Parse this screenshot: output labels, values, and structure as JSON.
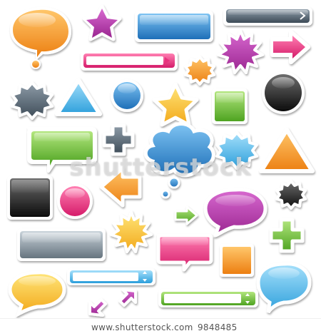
{
  "watermark": {
    "text": "shutterstock"
  },
  "footer": {
    "site": "www.shutterstock.com",
    "separator": "·",
    "image_id": "9848485"
  },
  "palette": {
    "orange": "#f39a2b",
    "magenta": "#b53aa7",
    "pink": "#e8337e",
    "blue": "#2f86cf",
    "sky": "#49b6e8",
    "green": "#6cbf3b",
    "yellow": "#f6c222",
    "black": "#1a1a1a",
    "slate": "#566775",
    "silver": "#8c99a4"
  },
  "icons": [
    "orange-speech-bubble-icon",
    "magenta-star-icon",
    "blue-pill-button-icon",
    "slate-arrow-bar-icon",
    "pink-right-arrow-icon",
    "magenta-starburst-icon",
    "pink-arrow-bar-icon",
    "orange-seal-icon",
    "slate-seal-icon",
    "blue-triangle-icon",
    "blue-circle-icon",
    "yellow-star-icon",
    "green-square-icon",
    "black-circle-icon",
    "green-speech-bubble-icon",
    "slate-plus-icon",
    "blue-thought-cloud-icon",
    "sky-seal-icon",
    "orange-triangle-icon",
    "black-rounded-square-icon",
    "pink-circle-icon",
    "orange-left-arrow-icon",
    "black-seal-icon",
    "green-small-arrow-icon",
    "magenta-speech-bubble-icon",
    "slate-bar-button-icon",
    "yellow-starburst-icon",
    "green-plus-icon",
    "pink-speech-bubble-icon",
    "orange-square-icon",
    "yellow-speech-bubble-icon",
    "sky-stepper-bar-icon",
    "sky-thought-bubble-icon",
    "magenta-diagonal-arrows-icon",
    "green-stepper-bar-icon"
  ]
}
